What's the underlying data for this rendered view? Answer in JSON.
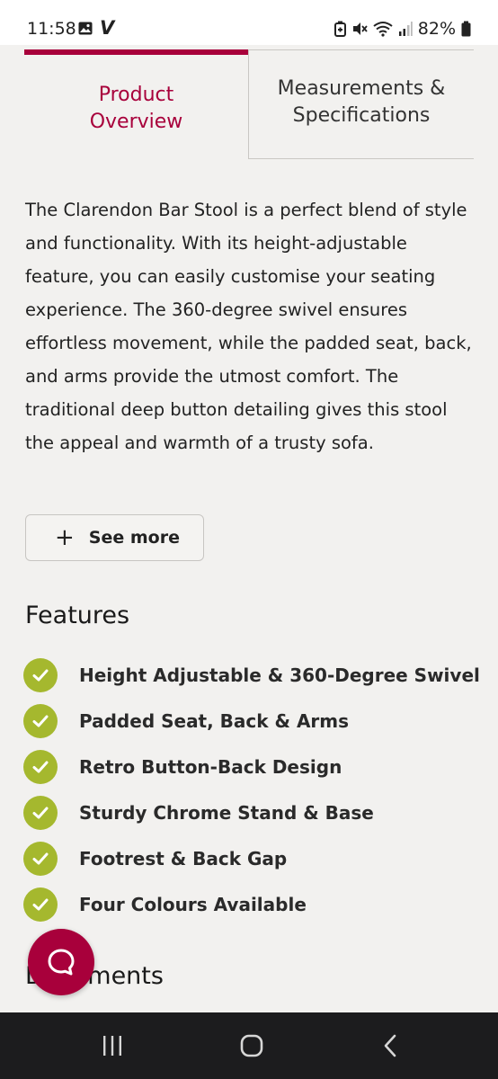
{
  "status_bar": {
    "time": "11:58",
    "app_letter": "V",
    "battery_percent": "82%",
    "icons": [
      "gallery-icon",
      "v-app-icon",
      "battery-saver-icon",
      "mute-icon",
      "wifi-icon",
      "signal-icon",
      "battery-icon"
    ]
  },
  "tabs": {
    "active": {
      "line1": "Product",
      "line2": "Overview"
    },
    "inactive": {
      "line1": "Measurements &",
      "line2": "Specifications"
    }
  },
  "description": "The Clarendon Bar Stool is a perfect blend of style and functionality. With its height-adjustable feature, you can easily customise your seating experience. The 360-degree swivel ensures effortless movement, while the padded seat, back, and arms provide the utmost comfort. The traditional deep button detailing gives this stool the appeal and warmth of a trusty sofa.",
  "see_more": {
    "icon": "+",
    "label": "See more"
  },
  "features": {
    "heading": "Features",
    "items": [
      "Height Adjustable & 360-Degree Swivel",
      "Padded Seat, Back & Arms",
      "Retro Button-Back Design",
      "Sturdy Chrome Stand & Base",
      "Footrest & Back Gap",
      "Four Colours Available"
    ]
  },
  "documents": {
    "heading": "Documents"
  },
  "colors": {
    "accent": "#a8003b",
    "check": "#a5b82e",
    "background": "#f2f1ef",
    "nav_bar": "#1c1c1e"
  }
}
